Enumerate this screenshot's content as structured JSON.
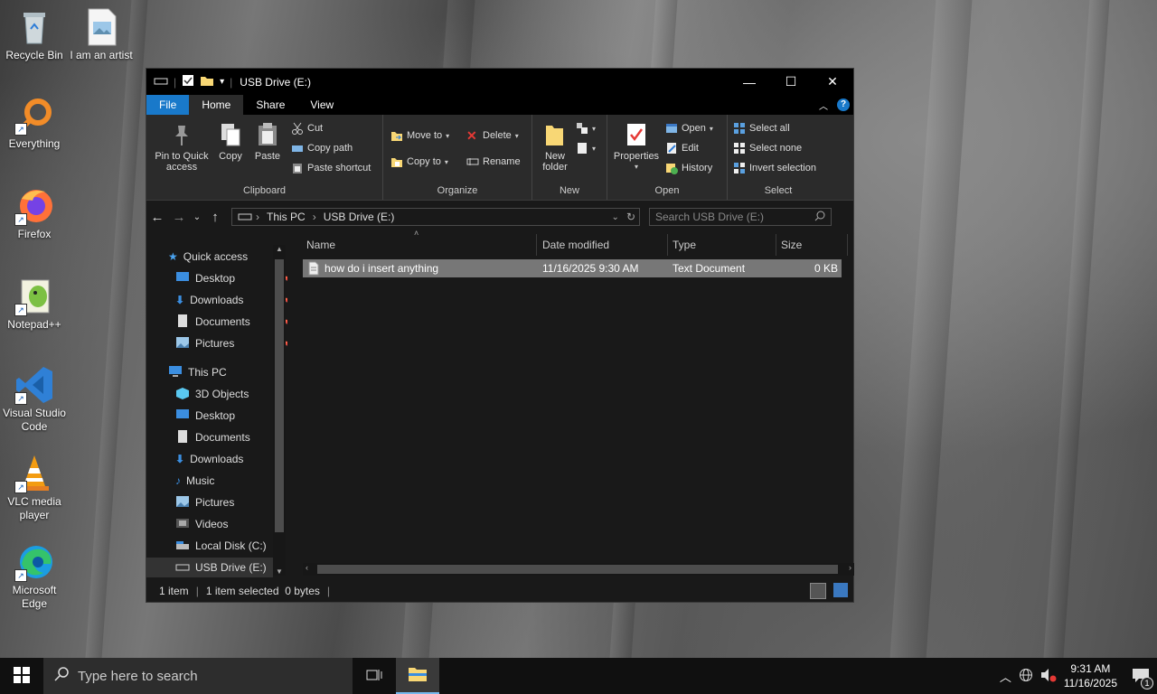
{
  "desktop": {
    "icons": [
      {
        "label": "Recycle Bin"
      },
      {
        "label": "I am an artist"
      },
      {
        "label": "Everything"
      },
      {
        "label": "Firefox"
      },
      {
        "label": "Notepad++"
      },
      {
        "label": "Visual Studio Code"
      },
      {
        "label": "VLC media player"
      },
      {
        "label": "Microsoft Edge"
      }
    ]
  },
  "window": {
    "title": "USB Drive (E:)",
    "tabs": [
      "File",
      "Home",
      "Share",
      "View"
    ],
    "ribbon": {
      "clipboard": {
        "pin": "Pin to Quick access",
        "copy": "Copy",
        "paste": "Paste",
        "cut": "Cut",
        "copy_path": "Copy path",
        "paste_shortcut": "Paste shortcut",
        "label": "Clipboard"
      },
      "organize": {
        "move_to": "Move to",
        "copy_to": "Copy to",
        "delete": "Delete",
        "rename": "Rename",
        "label": "Organize"
      },
      "new": {
        "new_folder": "New folder",
        "label": "New"
      },
      "open": {
        "properties": "Properties",
        "open": "Open",
        "edit": "Edit",
        "history": "History",
        "label": "Open"
      },
      "select": {
        "select_all": "Select all",
        "select_none": "Select none",
        "invert": "Invert selection",
        "label": "Select"
      }
    },
    "address": {
      "crumbs": [
        "This PC",
        "USB Drive (E:)"
      ],
      "search_placeholder": "Search USB Drive (E:)"
    },
    "nav": {
      "quick_access": "Quick access",
      "quick_items": [
        "Desktop",
        "Downloads",
        "Documents",
        "Pictures"
      ],
      "this_pc": "This PC",
      "pc_items": [
        "3D Objects",
        "Desktop",
        "Documents",
        "Downloads",
        "Music",
        "Pictures",
        "Videos",
        "Local Disk (C:)",
        "USB Drive (E:)"
      ]
    },
    "columns": [
      "Name",
      "Date modified",
      "Type",
      "Size"
    ],
    "files": [
      {
        "name": "how do i insert anything",
        "date": "11/16/2025 9:30 AM",
        "type": "Text Document",
        "size": "0 KB"
      }
    ],
    "status": {
      "count": "1 item",
      "selection": "1 item selected  0 bytes"
    }
  },
  "taskbar": {
    "search_placeholder": "Type here to search",
    "time": "9:31 AM",
    "date": "11/16/2025",
    "notifications": "1"
  }
}
